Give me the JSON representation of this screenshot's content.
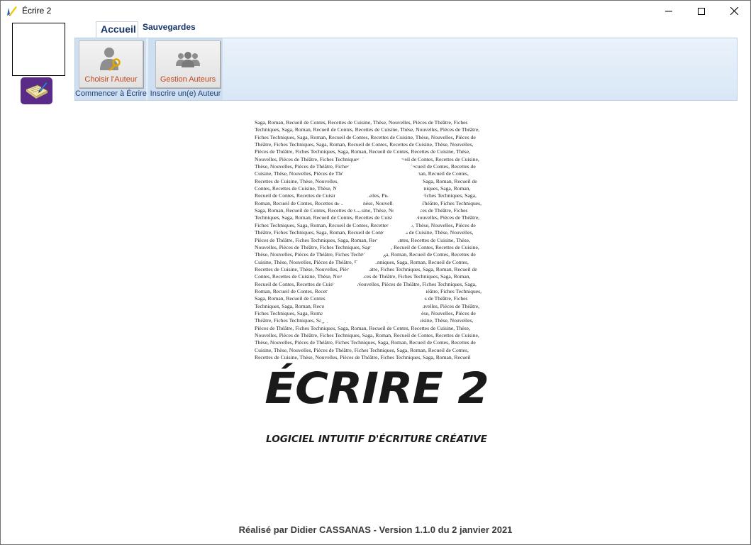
{
  "window": {
    "title": "Écrire 2",
    "icon": "quill-pen-icon",
    "controls": [
      "minimize-icon",
      "maximize-icon",
      "close-icon"
    ]
  },
  "sidebar": {
    "author_photo": "",
    "app_icon": "notebook-pen-icon"
  },
  "ribbon": {
    "tabs": [
      {
        "label": "Accueil",
        "active": true
      },
      {
        "label": "Sauvegardes",
        "active": false
      }
    ],
    "groups": [
      {
        "button_label": "Choisir l'Auteur",
        "icon": "user-key-icon",
        "group_label": "Commencer à Écrire"
      },
      {
        "button_label": "Gestion Auteurs",
        "icon": "users-group-icon",
        "group_label": "Inscrire un(e) Auteur"
      }
    ]
  },
  "logo": {
    "word_lines": [
      "Saga, Roman, Recueil de Contes, Recettes de Cuisine, Thèse, Nouvelles, Pièces de Théâtre, Fiches",
      "Techniques, Saga, Roman, Recueil de Contes, Recettes de Cuisine, Thèse, Nouvelles, Pièces de Théâtre,",
      "Fiches Techniques, Saga, Roman, Recueil de Contes, Recettes de Cuisine, Thèse, Nouvelles, Pièces de",
      "Théâtre, Fiches Techniques, Saga, Roman, Recueil de Contes, Recettes de Cuisine, Thèse, Nouvelles,",
      "Pièces de Théâtre, Fiches Techniques, Saga, Roman, Recueil de Contes, Recettes de Cuisine, Thèse,",
      "Nouvelles, Pièces de Théâtre, Fiches Techniques, Saga, Roman, Recueil de Contes, Recettes de Cuisine,",
      "Thèse, Nouvelles, Pièces de Théâtre, Fiches Techniques, Saga, Roman, Recueil de Contes, Recettes de",
      "Cuisine, Thèse, Nouvelles, Pièces de Théâtre, Fiches Techniques, Saga, Roman, Recueil de Contes,",
      "Recettes de Cuisine, Thèse, Nouvelles, Pièces de Théâtre, Fiches Techniques, Saga, Roman, Recueil de",
      "Contes, Recettes de Cuisine, Thèse, Nouvelles, Pièces de Théâtre, Fiches Techniques, Saga, Roman,",
      "Recueil de Contes, Recettes de Cuisine, Thèse, Nouvelles, Pièces de Théâtre, Fiches Techniques, Saga,",
      "Roman, Recueil de Contes, Recettes de Cuisine, Thèse, Nouvelles, Pièces de Théâtre, Fiches Techniques,",
      "Saga, Roman, Recueil de Contes, Recettes de Cuisine, Thèse, Nouvelles, Pièces de Théâtre, Fiches",
      "Techniques, Saga, Roman, Recueil de Contes, Recettes de Cuisine, Thèse, Nouvelles, Pièces de Théâtre,",
      "Fiches Techniques, Saga, Roman, Recueil de Contes, Recettes de Cuisine, Thèse, Nouvelles, Pièces de",
      "Théâtre, Fiches Techniques, Saga, Roman, Recueil de Contes, Recettes de Cuisine, Thèse, Nouvelles,",
      "Pièces de Théâtre, Fiches Techniques, Saga, Roman, Recueil de Contes, Recettes de Cuisine, Thèse,",
      "Nouvelles, Pièces de Théâtre, Fiches Techniques, Saga, Roman, Recueil de Contes, Recettes de Cuisine,",
      "Thèse, Nouvelles, Pièces de Théâtre, Fiches Techniques, Saga, Roman, Recueil de Contes, Recettes de",
      "Cuisine, Thèse, Nouvelles, Pièces de Théâtre, Fiches Techniques, Saga, Roman, Recueil de Contes,",
      "Recettes de Cuisine, Thèse, Nouvelles, Pièces de Théâtre, Fiches Techniques, Saga, Roman, Recueil de",
      "Contes, Recettes de Cuisine, Thèse, Nouvelles, Pièces de Théâtre, Fiches Techniques, Saga, Roman,",
      "Recueil de Contes, Recettes de Cuisine, Thèse, Nouvelles, Pièces de Théâtre, Fiches Techniques, Saga,",
      "Roman, Recueil de Contes, Recettes de Cuisine, Thèse, Nouvelles, Pièces de Théâtre, Fiches Techniques,",
      "Saga, Roman, Recueil de Contes, Recettes de Cuisine, Thèse, Nouvelles, Pièces de Théâtre, Fiches",
      "Techniques, Saga, Roman, Recueil de Contes, Recettes de Cuisine, Thèse, Nouvelles, Pièces de Théâtre,",
      "Fiches Techniques, Saga, Roman, Recueil de Contes, Recettes de Cuisine, Thèse, Nouvelles, Pièces de",
      "Théâtre, Fiches Techniques, Saga, Roman, Recueil de Contes, Recettes de Cuisine, Thèse, Nouvelles,",
      "Pièces de Théâtre, Fiches Techniques, Saga, Roman, Recueil de Contes, Recettes de Cuisine, Thèse,",
      "Nouvelles, Pièces de Théâtre, Fiches Techniques, Saga, Roman, Recueil de Contes, Recettes de Cuisine,",
      "Thèse, Nouvelles, Pièces de Théâtre, Fiches Techniques, Saga, Roman, Recueil de Contes, Recettes de",
      "Cuisine, Thèse, Nouvelles, Pièces de Théâtre, Fiches Techniques, Saga, Roman, Recueil de Contes,",
      "Recettes de Cuisine, Thèse, Nouvelles, Pièces de Théâtre, Fiches Techniques, Saga, Roman, Recueil"
    ],
    "title": "ÉCRIRE 2",
    "subtitle": "LOGICIEL INTUITIF D'ÉCRITURE CRÉATIVE"
  },
  "footer": {
    "text": "Réalisé par Didier CASSANAS - Version 1.1.0 du 2 janvier 2021"
  },
  "colors": {
    "tab_text": "#17346a",
    "button_label": "#c5461b",
    "ribbon_bg": "#d9e7f6",
    "app_icon_bg": "#5b2b8a"
  }
}
